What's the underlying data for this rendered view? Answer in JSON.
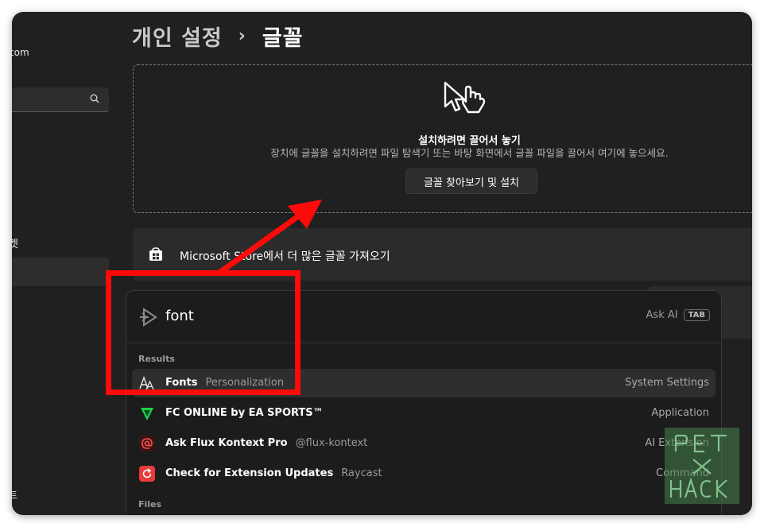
{
  "sidebar": {
    "email_fragment": "com",
    "fragment_1": "켓",
    "fragment_2": "트"
  },
  "breadcrumb": {
    "parent": "개인 설정",
    "separator": "›",
    "current": "글꼴"
  },
  "dropzone": {
    "title": "설치하려면 끌어서 놓기",
    "description": "장치에 글꼴을 설치하려면 파일 탐색기 또는 바탕 화면에서 글꼴 파일을 끌어서 여기에 놓으세요.",
    "button_label": "글꼴 찾아보기 및 설치"
  },
  "store_row": {
    "label": "Microsoft Store에서 더 많은 글꼴 가져오기"
  },
  "launcher": {
    "query": "font",
    "ask_ai_label": "Ask AI",
    "tab_key": "TAB",
    "sections": {
      "results": "Results",
      "files": "Files"
    },
    "items": [
      {
        "title": "Fonts",
        "subtitle": "Personalization",
        "type": "System Settings",
        "icon": "font-aa-icon",
        "selected": true
      },
      {
        "title": "FC ONLINE by EA SPORTS™",
        "subtitle": "",
        "type": "Application",
        "icon": "fc-online-icon",
        "selected": false
      },
      {
        "title": "Ask Flux Kontext Pro",
        "subtitle": "@flux-kontext",
        "type": "AI Extension",
        "icon": "at-sign-icon",
        "selected": false
      },
      {
        "title": "Check for Extension Updates",
        "subtitle": "Raycast",
        "type": "Command",
        "icon": "refresh-icon",
        "selected": false
      }
    ]
  },
  "colors": {
    "window_bg": "#202020",
    "card_bg": "#2b2b2b",
    "launcher_bg": "#1c1c1c",
    "annotation_red": "#ff0a0a"
  }
}
